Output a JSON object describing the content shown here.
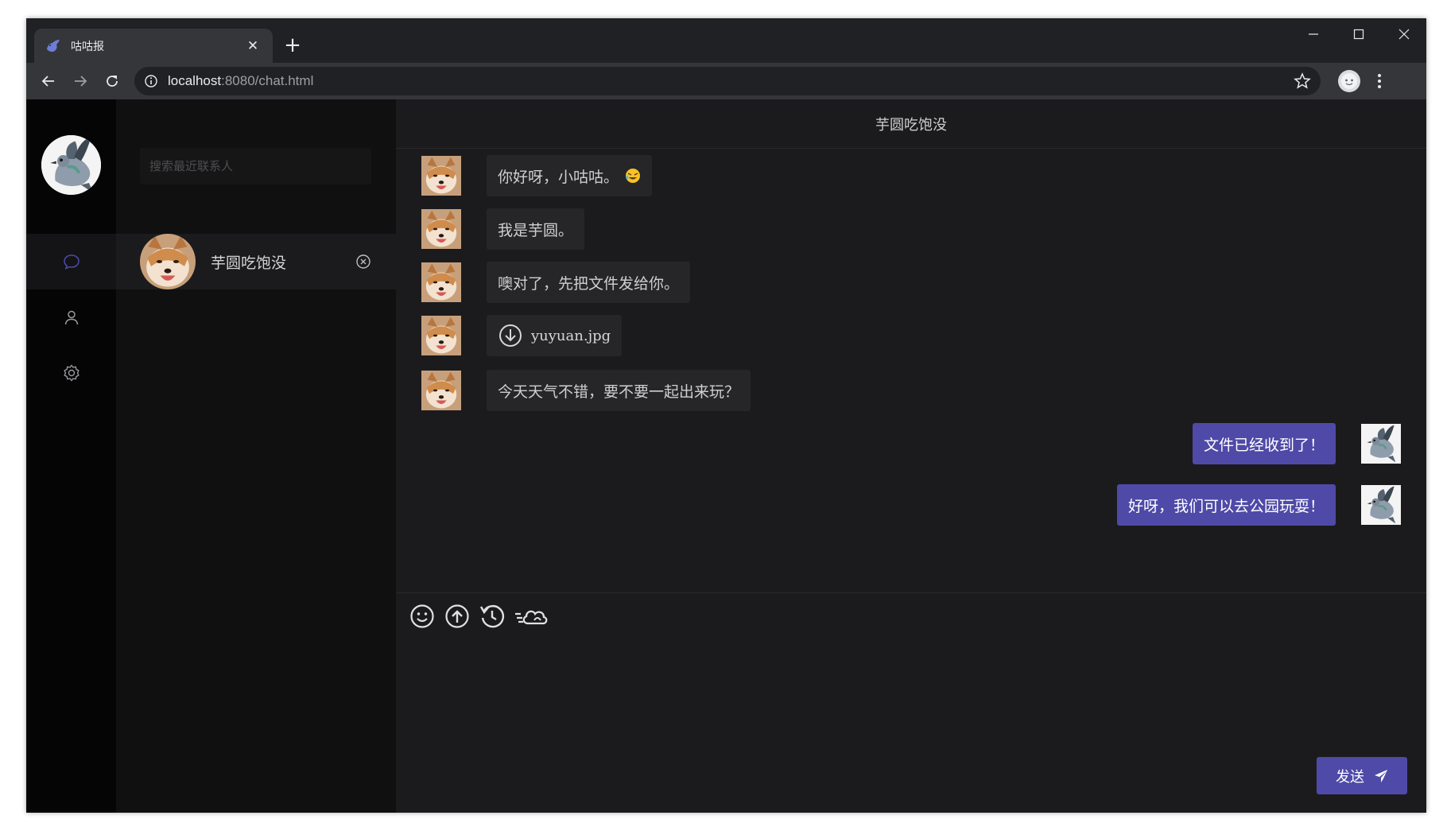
{
  "browser": {
    "tab_title": "咕咕报",
    "tab_favicon": "pigeon-icon",
    "url_host": "localhost",
    "url_rest": ":8080/chat.html"
  },
  "sidebar": {
    "search_placeholder": "搜索最近联系人",
    "menu": [
      {
        "icon": "chat-bubble-icon",
        "active": true
      },
      {
        "icon": "user-icon",
        "active": false
      },
      {
        "icon": "gear-icon",
        "active": false
      }
    ]
  },
  "contacts": [
    {
      "name": "芋圆吃饱没"
    }
  ],
  "chat": {
    "title": "芋圆吃饱没",
    "messages": [
      {
        "side": "left",
        "text": "你好呀，小咕咕。",
        "emoji": "rofl-emoji"
      },
      {
        "side": "left",
        "text": "我是芋圆。"
      },
      {
        "side": "left",
        "text": "噢对了，先把文件发给你。"
      },
      {
        "side": "left",
        "type": "file",
        "filename": "yuyuan.jpg"
      },
      {
        "side": "left",
        "text": "今天天气不错，要不要一起出来玩？"
      },
      {
        "side": "right",
        "text": "文件已经收到了！"
      },
      {
        "side": "right",
        "text": "好呀，我们可以去公园玩耍！"
      }
    ],
    "tools": [
      "smile-icon",
      "upload-icon",
      "history-icon",
      "cloud-icon"
    ],
    "send_label": "发送"
  },
  "colors": {
    "accent": "#4f4aa7",
    "background": "#1b1b1d",
    "sidebar": "#050506",
    "contacts": "#101011"
  }
}
